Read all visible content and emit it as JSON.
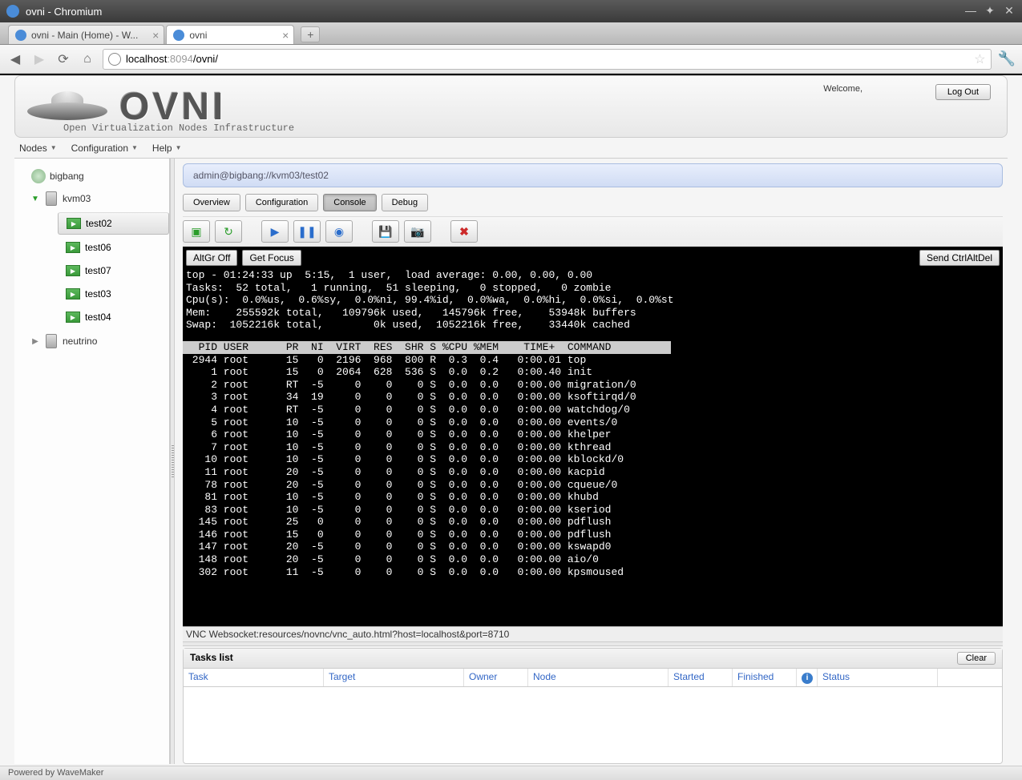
{
  "window": {
    "title": "ovni - Chromium"
  },
  "browser": {
    "tabs": [
      {
        "title": "ovni - Main (Home) - W...",
        "active": false
      },
      {
        "title": "ovni",
        "active": true
      }
    ],
    "url_host": "localhost",
    "url_port": ":8094",
    "url_path": "/ovni/"
  },
  "header": {
    "logo_text": "OVNI",
    "subtitle": "Open Virtualization Nodes Infrastructure",
    "welcome": "Welcome,",
    "logout": "Log Out"
  },
  "menu": {
    "items": [
      "Nodes",
      "Configuration",
      "Help"
    ]
  },
  "tree": {
    "root": "bigbang",
    "node_open": "kvm03",
    "vms": [
      "test02",
      "test06",
      "test07",
      "test03",
      "test04"
    ],
    "selected_vm": "test02",
    "node_closed": "neutrino"
  },
  "breadcrumb": "admin@bigbang://kvm03/test02",
  "tabs": {
    "items": [
      "Overview",
      "Configuration",
      "Console",
      "Debug"
    ],
    "active": "Console"
  },
  "console": {
    "buttons": {
      "altgr": "AltGr Off",
      "focus": "Get Focus",
      "cad": "Send CtrlAltDel"
    },
    "summary": [
      "top - 01:24:33 up  5:15,  1 user,  load average: 0.00, 0.00, 0.00",
      "Tasks:  52 total,   1 running,  51 sleeping,   0 stopped,   0 zombie",
      "Cpu(s):  0.0%us,  0.6%sy,  0.0%ni, 99.4%id,  0.0%wa,  0.0%hi,  0.0%si,  0.0%st",
      "Mem:    255592k total,   109796k used,   145796k free,    53948k buffers",
      "Swap:  1052216k total,        0k used,  1052216k free,    33440k cached"
    ],
    "header": "  PID USER      PR  NI  VIRT  RES  SHR S %CPU %MEM    TIME+  COMMAND         ",
    "rows": [
      " 2944 root      15   0  2196  968  800 R  0.3  0.4   0:00.01 top",
      "    1 root      15   0  2064  628  536 S  0.0  0.2   0:00.40 init",
      "    2 root      RT  -5     0    0    0 S  0.0  0.0   0:00.00 migration/0",
      "    3 root      34  19     0    0    0 S  0.0  0.0   0:00.00 ksoftirqd/0",
      "    4 root      RT  -5     0    0    0 S  0.0  0.0   0:00.00 watchdog/0",
      "    5 root      10  -5     0    0    0 S  0.0  0.0   0:00.00 events/0",
      "    6 root      10  -5     0    0    0 S  0.0  0.0   0:00.00 khelper",
      "    7 root      10  -5     0    0    0 S  0.0  0.0   0:00.00 kthread",
      "   10 root      10  -5     0    0    0 S  0.0  0.0   0:00.00 kblockd/0",
      "   11 root      20  -5     0    0    0 S  0.0  0.0   0:00.00 kacpid",
      "   78 root      20  -5     0    0    0 S  0.0  0.0   0:00.00 cqueue/0",
      "   81 root      10  -5     0    0    0 S  0.0  0.0   0:00.00 khubd",
      "   83 root      10  -5     0    0    0 S  0.0  0.0   0:00.00 kseriod",
      "  145 root      25   0     0    0    0 S  0.0  0.0   0:00.00 pdflush",
      "  146 root      15   0     0    0    0 S  0.0  0.0   0:00.00 pdflush",
      "  147 root      20  -5     0    0    0 S  0.0  0.0   0:00.00 kswapd0",
      "  148 root      20  -5     0    0    0 S  0.0  0.0   0:00.00 aio/0",
      "  302 root      11  -5     0    0    0 S  0.0  0.0   0:00.00 kpsmoused"
    ],
    "vnc_status": "VNC Websocket:resources/novnc/vnc_auto.html?host=localhost&port=8710"
  },
  "tasks": {
    "title": "Tasks list",
    "clear": "Clear",
    "columns": [
      "Task",
      "Target",
      "Owner",
      "Node",
      "Started",
      "Finished",
      "",
      "Status"
    ]
  },
  "footer": "Powered by WaveMaker"
}
